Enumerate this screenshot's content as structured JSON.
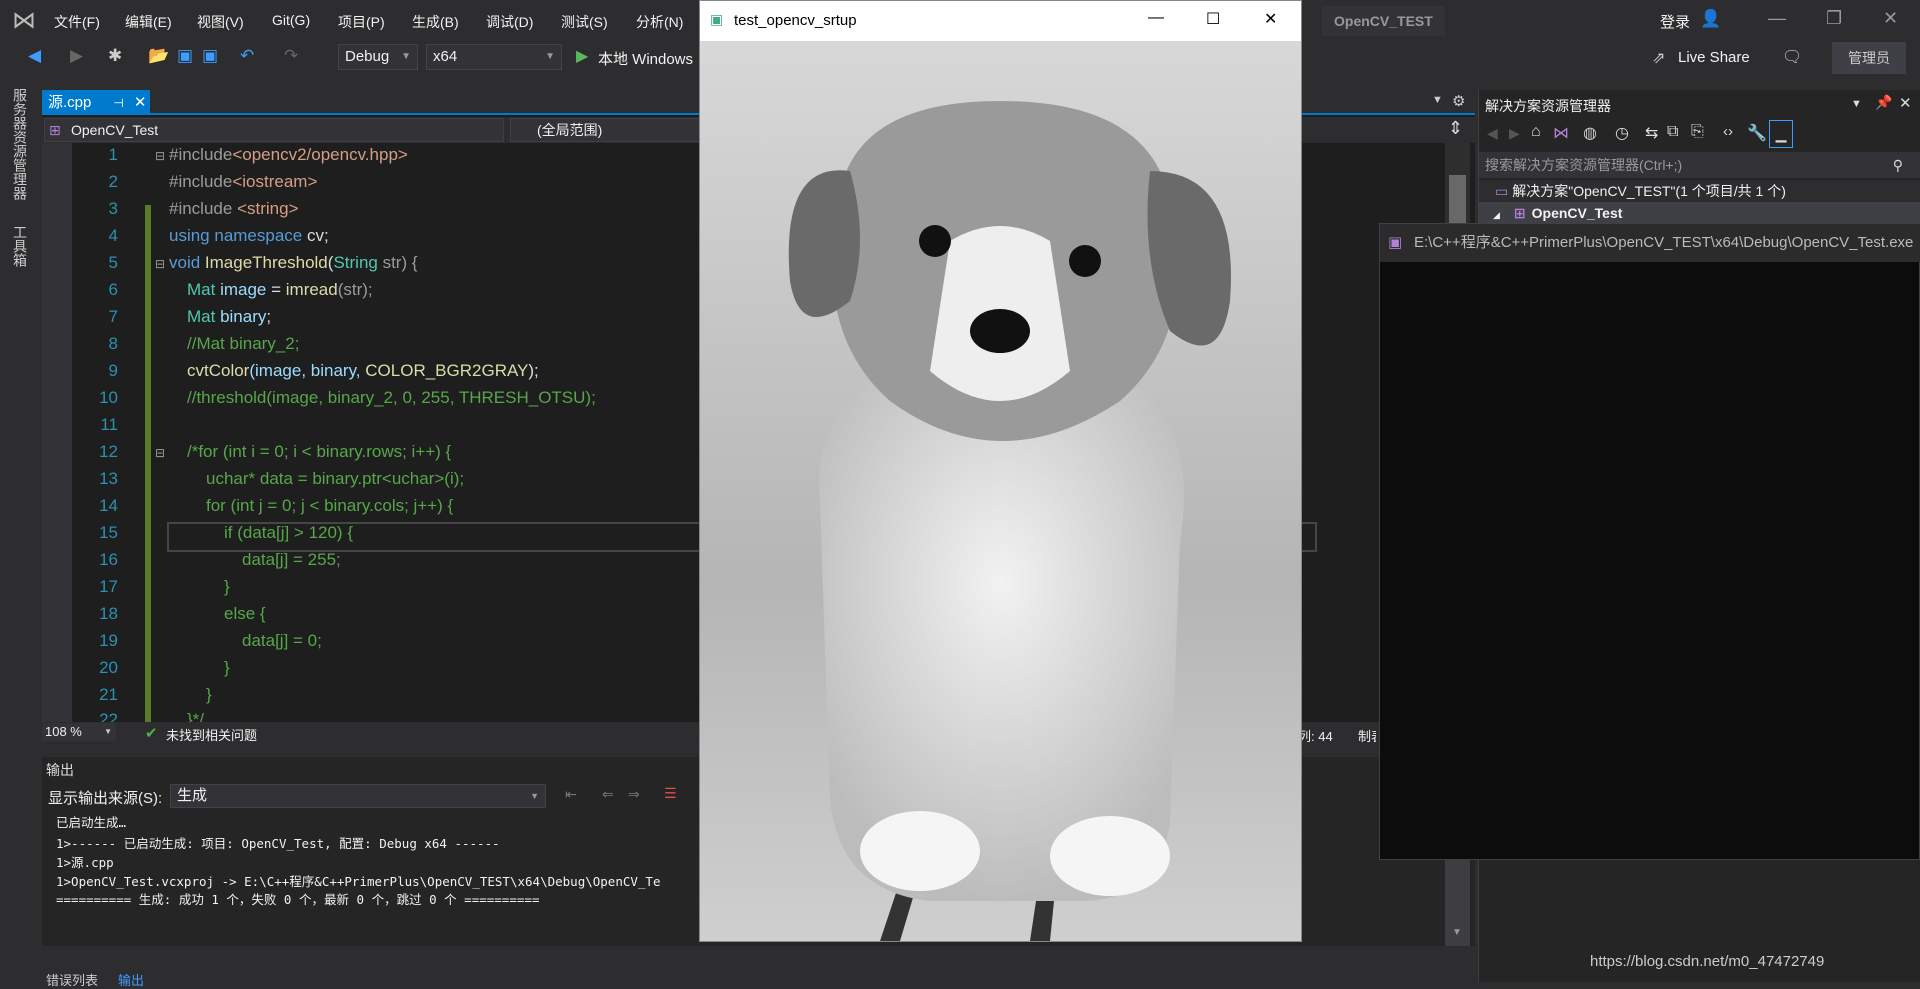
{
  "menu": [
    "文件(F)",
    "编辑(E)",
    "视图(V)",
    "Git(G)",
    "项目(P)",
    "生成(B)",
    "调试(D)",
    "测试(S)",
    "分析(N)"
  ],
  "solution_name": "OpenCV_TEST",
  "login": "登录",
  "toolbar": {
    "config": "Debug",
    "platform": "x64",
    "run": "本地 Windows",
    "live_share": "Live Share",
    "admin": "管理员"
  },
  "left_tabs": [
    "服务器资源管理器",
    "工具箱"
  ],
  "editor": {
    "tab": "源.cpp",
    "project_combo": "OpenCV_Test",
    "scope_combo": "(全局范围)",
    "line_numbers": [
      "1",
      "2",
      "3",
      "4",
      "5",
      "6",
      "7",
      "8",
      "9",
      "10",
      "11",
      "12",
      "13",
      "14",
      "15",
      "16",
      "17",
      "18",
      "19",
      "20",
      "21",
      "22"
    ],
    "lines": {
      "l1a": "#include",
      "l1b": "<opencv2/opencv.hpp>",
      "l2a": "#include",
      "l2b": "<iostream>",
      "l3a": "#include ",
      "l3b": "<string>",
      "l4a": "using namespace ",
      "l4b": "cv;",
      "l5a": "void ",
      "l5b": "ImageThreshold",
      "l5c": "(",
      "l5d": "String",
      "l5e": " str) {",
      "l6a": "Mat ",
      "l6b": "image",
      "l6c": " = ",
      "l6d": "imread",
      "l6e": "(str);",
      "l7a": "Mat ",
      "l7b": "binary",
      "l7c": ";",
      "l8": "//Mat binary_2;",
      "l9a": "cvtColor",
      "l9b": "(image, binary, ",
      "l9c": "COLOR_BGR2GRAY",
      "l9d": ");",
      "l10": "//threshold(image, binary_2, 0, 255, THRESH_OTSU);",
      "l12": "/*for (int i = 0; i < binary.rows; i++) {",
      "l13": "uchar* data = binary.ptr<uchar>(i);",
      "l14": "for (int j = 0; j < binary.cols; j++) {",
      "l15": "if (data[j] > 120) {",
      "l16": "data[j] = 255;",
      "l17": "}",
      "l18": "else {",
      "l19": "data[j] = 0;",
      "l20": "}",
      "l21": "}",
      "l22": "}*/"
    }
  },
  "status": {
    "zoom": "108 %",
    "issues": "未找到相关问题",
    "col": "列: 44",
    "tab": "制表"
  },
  "output": {
    "title": "输出",
    "source_label": "显示输出来源(S):",
    "source_value": "生成",
    "lines": [
      "已启动生成…",
      "1>------ 已启动生成: 项目: OpenCV_Test, 配置: Debug x64 ------",
      "1>源.cpp",
      "1>OpenCV_Test.vcxproj -> E:\\C++程序&C++PrimerPlus\\OpenCV_TEST\\x64\\Debug\\OpenCV_Te",
      "========== 生成: 成功 1 个，失败 0 个，最新 0 个，跳过 0 个 =========="
    ]
  },
  "bottom_tabs": [
    "错误列表",
    "输出"
  ],
  "image_window": {
    "title": "test_opencv_srtup"
  },
  "solution_explorer": {
    "title": "解决方案资源管理器",
    "search_placeholder": "搜索解决方案资源管理器(Ctrl+;)",
    "solution_item": "解决方案\"OpenCV_TEST\"(1 个项目/共 1 个)",
    "project_item": "OpenCV_Test"
  },
  "console": {
    "title": "E:\\C++程序&C++PrimerPlus\\OpenCV_TEST\\x64\\Debug\\OpenCV_Test.exe"
  },
  "watermark": "https://blog.csdn.net/m0_47472749",
  "colors": {
    "accent": "#007acc",
    "comment": "#57a64a",
    "keyword": "#569cd6",
    "type": "#4ec9b0"
  }
}
